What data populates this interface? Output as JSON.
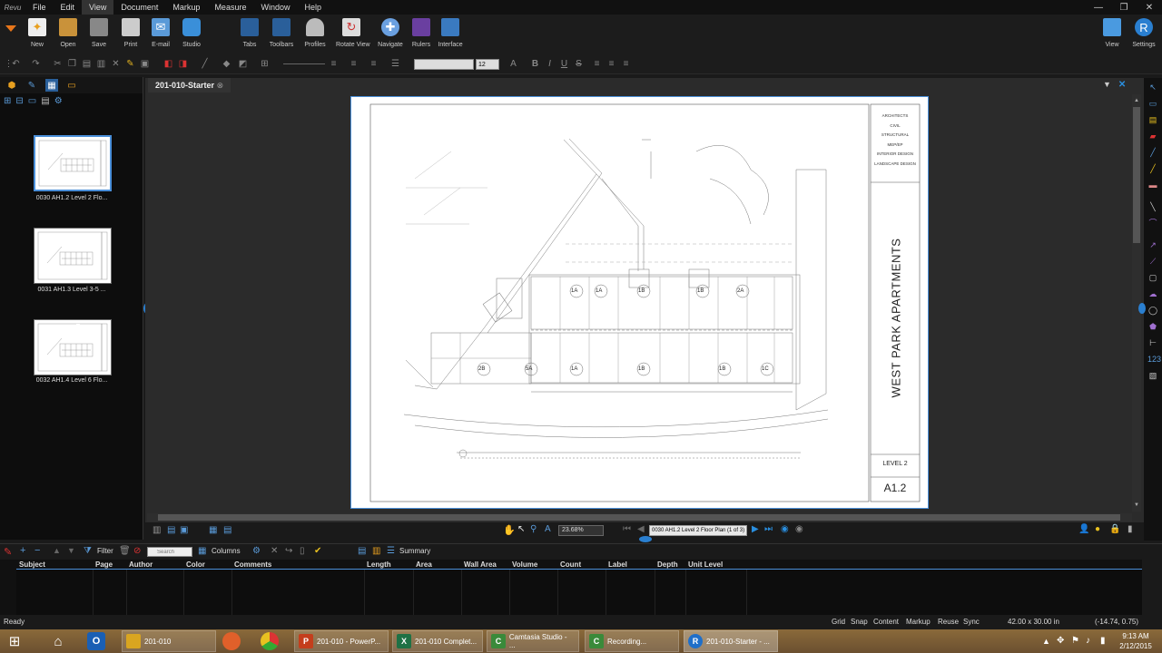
{
  "app": {
    "logo": "Revu"
  },
  "menu": [
    "File",
    "Edit",
    "View",
    "Document",
    "Markup",
    "Measure",
    "Window",
    "Help"
  ],
  "ribbon": {
    "left": [
      {
        "label": "New",
        "icon": "new-icon"
      },
      {
        "label": "Open",
        "icon": "open-icon"
      },
      {
        "label": "Save",
        "icon": "save-icon"
      },
      {
        "label": "Print",
        "icon": "print-icon"
      },
      {
        "label": "E-mail",
        "icon": "email-icon"
      },
      {
        "label": "Studio",
        "icon": "studio-icon"
      }
    ],
    "middle": [
      {
        "label": "Tabs",
        "icon": "tabs-icon"
      },
      {
        "label": "Toolbars",
        "icon": "toolbars-icon"
      },
      {
        "label": "Profiles",
        "icon": "profiles-icon"
      },
      {
        "label": "Rotate View",
        "icon": "rotate-view-icon"
      },
      {
        "label": "Navigate",
        "icon": "navigate-icon"
      },
      {
        "label": "Rulers",
        "icon": "rulers-icon"
      },
      {
        "label": "Interface",
        "icon": "interface-icon"
      }
    ],
    "right": [
      {
        "label": "View",
        "icon": "view-icon"
      },
      {
        "label": "Settings",
        "icon": "settings-icon"
      }
    ]
  },
  "format_bar": {
    "font_size": "12"
  },
  "thumbnails": [
    {
      "label": "0030 AH1.2 Level 2 Flo..."
    },
    {
      "label": "0031 AH1.3 Level 3-5 ..."
    },
    {
      "label": "0032 AH1.4 Level 6 Flo..."
    }
  ],
  "document_tab": "201-010-Starter",
  "drawing": {
    "disciplines": [
      "ARCHITECTS",
      "CIVIL",
      "STRUCTURAL",
      "MEP/EP",
      "INTERIOR DESIGN",
      "LANDSCAPE DESIGN"
    ],
    "project_title": "WEST PARK APARTMENTS",
    "sheet_name": "LEVEL 2",
    "sheet_number": "A1.2",
    "unit_tags": [
      "1A",
      "1A",
      "1B",
      "1B",
      "2A",
      "2B",
      "5A",
      "1A",
      "1B",
      "1B",
      "1C"
    ]
  },
  "navigation": {
    "zoom": "23.68%",
    "page_field": "0030 AH1.2 Level 2 Floor Plan (1 of 3)"
  },
  "markups_bar": {
    "filter_label": "Filter",
    "search_placeholder": "Search",
    "columns_label": "Columns",
    "summary_label": "Summary"
  },
  "markups_columns": [
    "Subject",
    "Page",
    "Author",
    "Color",
    "Comments",
    "Length",
    "Area",
    "Wall Area",
    "Volume",
    "Count",
    "Label",
    "Depth",
    "Unit Level"
  ],
  "status": {
    "left": "Ready",
    "toggles": [
      "Grid",
      "Snap",
      "Content",
      "Markup",
      "Reuse",
      "Sync"
    ],
    "dimensions": "42.00 x 30.00 in",
    "coords": "(-14.74, 0.75)"
  },
  "taskbar": {
    "items": [
      {
        "label": "201-010",
        "icon": "folder-icon",
        "color": "#d9a520"
      },
      {
        "label": "201-010 - PowerP...",
        "icon": "powerpoint-icon",
        "color": "#c43e1c"
      },
      {
        "label": "201-010 Complet...",
        "icon": "excel-icon",
        "color": "#1e7145"
      },
      {
        "label": "Camtasia Studio - ...",
        "icon": "camtasia-icon",
        "color": "#3a8a3a"
      },
      {
        "label": "Recording...",
        "icon": "camtasia-recorder-icon",
        "color": "#3a8a3a"
      },
      {
        "label": "201-010-Starter - ...",
        "icon": "revu-icon",
        "color": "#1f6fc9"
      }
    ],
    "time": "9:13 AM",
    "date": "2/12/2015"
  }
}
